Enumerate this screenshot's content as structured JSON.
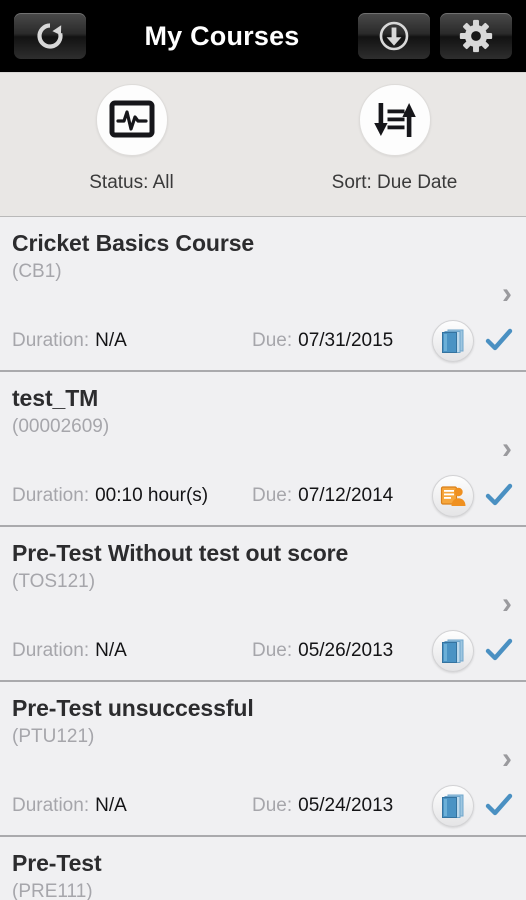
{
  "header": {
    "title": "My Courses",
    "refresh_icon": "refresh-icon",
    "download_icon": "download-icon",
    "settings_icon": "gear-icon"
  },
  "filters": {
    "status": {
      "label": "Status: All",
      "icon": "monitor-pulse-icon"
    },
    "sort": {
      "label": "Sort: Due Date",
      "icon": "sort-arrows-icon"
    }
  },
  "labels": {
    "duration": "Duration:",
    "due": "Due:",
    "chevron": "›"
  },
  "colors": {
    "header_bg": "#000000",
    "filterbar_bg": "#e9e7e5",
    "list_bg": "#f0f0f2",
    "divider": "#aaaaad",
    "title_text": "#2c2c2e",
    "muted_text": "#a6a6ab",
    "check_blue": "#4a90c2",
    "book_blue": "#4a93c4",
    "instructor_orange": "#ef9020"
  },
  "courses": [
    {
      "title": "Cricket Basics Course",
      "code": "(CB1)",
      "duration": "N/A",
      "due": "07/31/2015",
      "type_icon": "book-icon",
      "completed": true
    },
    {
      "title": "test_TM",
      "code": "(00002609)",
      "duration": "00:10 hour(s)",
      "due": "07/12/2014",
      "type_icon": "instructor-led-icon",
      "completed": true
    },
    {
      "title": "Pre-Test Without test out score",
      "code": "(TOS121)",
      "duration": "N/A",
      "due": "05/26/2013",
      "type_icon": "book-icon",
      "completed": true
    },
    {
      "title": "Pre-Test unsuccessful",
      "code": "(PTU121)",
      "duration": "N/A",
      "due": "05/24/2013",
      "type_icon": "book-icon",
      "completed": true
    },
    {
      "title": "Pre-Test",
      "code": "(PRE111)",
      "duration": "",
      "due": "",
      "type_icon": "book-icon",
      "completed": true
    }
  ]
}
